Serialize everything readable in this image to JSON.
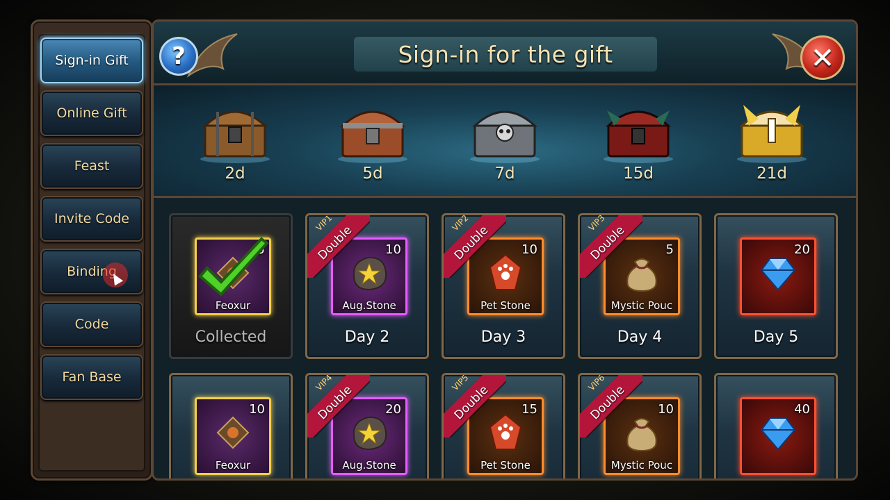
{
  "sidebar": {
    "items": [
      {
        "label": "Sign-in Gift",
        "active": true
      },
      {
        "label": "Online Gift",
        "active": false
      },
      {
        "label": "Feast",
        "active": false
      },
      {
        "label": "Invite Code",
        "active": false
      },
      {
        "label": "Binding",
        "active": false
      },
      {
        "label": "Code",
        "active": false
      },
      {
        "label": "Fan Base",
        "active": false
      }
    ]
  },
  "header": {
    "title": "Sign-in for the gift",
    "help_symbol": "?",
    "close_symbol": "✕"
  },
  "chests": [
    {
      "label": "2d",
      "icon": "wooden-chest-icon"
    },
    {
      "label": "5d",
      "icon": "bronze-chest-icon"
    },
    {
      "label": "7d",
      "icon": "silver-skull-chest-icon"
    },
    {
      "label": "15d",
      "icon": "red-dragon-chest-icon"
    },
    {
      "label": "21d",
      "icon": "golden-chest-icon"
    }
  ],
  "rows": [
    [
      {
        "day": "Collected",
        "item": "Feoxur",
        "count": "5",
        "frame": "gold",
        "collected": true,
        "vip": "",
        "double": ""
      },
      {
        "day": "Day 2",
        "item": "Aug.Stone",
        "count": "10",
        "frame": "purple",
        "collected": false,
        "vip": "VIP1",
        "double": "Double"
      },
      {
        "day": "Day 3",
        "item": "Pet Stone",
        "count": "10",
        "frame": "orange",
        "collected": false,
        "vip": "VIP2",
        "double": "Double"
      },
      {
        "day": "Day 4",
        "item": "Mystic Pouc",
        "count": "5",
        "frame": "orange",
        "collected": false,
        "vip": "VIP3",
        "double": "Double"
      },
      {
        "day": "Day 5",
        "item": "",
        "count": "20",
        "frame": "red",
        "collected": false,
        "vip": "",
        "double": ""
      }
    ],
    [
      {
        "day": "",
        "item": "Feoxur",
        "count": "10",
        "frame": "gold",
        "collected": false,
        "vip": "",
        "double": ""
      },
      {
        "day": "",
        "item": "Aug.Stone",
        "count": "20",
        "frame": "purple",
        "collected": false,
        "vip": "VIP4",
        "double": "Double"
      },
      {
        "day": "",
        "item": "Pet Stone",
        "count": "15",
        "frame": "orange",
        "collected": false,
        "vip": "VIP5",
        "double": "Double"
      },
      {
        "day": "",
        "item": "Mystic Pouc",
        "count": "10",
        "frame": "orange",
        "collected": false,
        "vip": "VIP6",
        "double": "Double"
      },
      {
        "day": "",
        "item": "",
        "count": "40",
        "frame": "red",
        "collected": false,
        "vip": "",
        "double": ""
      }
    ]
  ],
  "colors": {
    "title_text": "#f5e3b4",
    "active_tab": "#4a88b6",
    "ribbon": "#b3163a",
    "frame_orange": "#ff8c2a",
    "frame_purple": "#e45cff",
    "frame_red": "#ff5030",
    "frame_gold": "#f2cf4a"
  }
}
